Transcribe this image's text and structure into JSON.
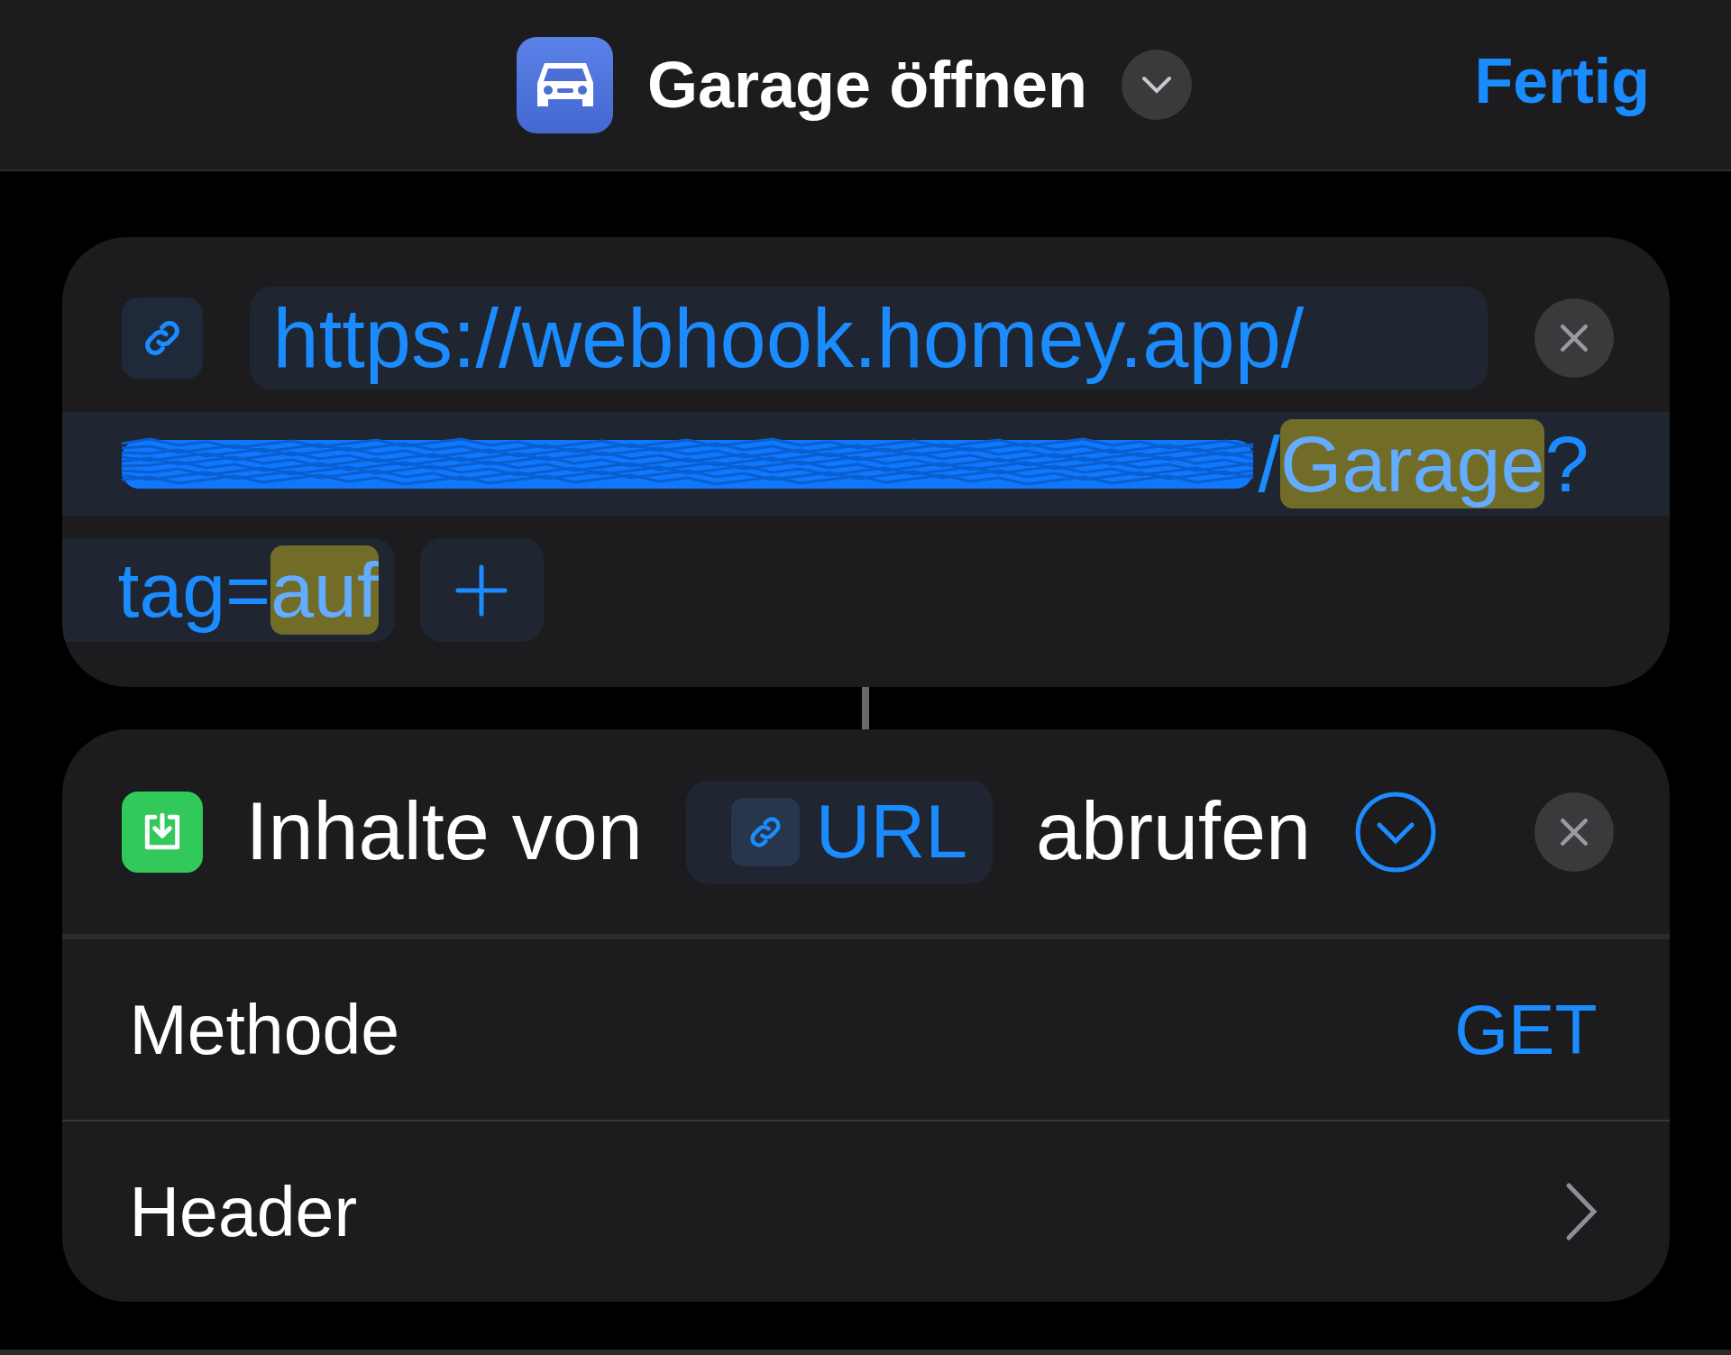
{
  "header": {
    "title": "Garage öffnen",
    "done": "Fertig"
  },
  "url_action": {
    "url": "https://webhook.homey.app/",
    "path": [
      {
        "text": "/",
        "highlighted": false
      },
      {
        "text": "Garage",
        "highlighted": true
      },
      {
        "text": "?",
        "highlighted": false
      }
    ],
    "param": [
      {
        "text": "tag=",
        "highlighted": false
      },
      {
        "text": "auf",
        "highlighted": true
      }
    ]
  },
  "fetch_action": {
    "prefix": "Inhalte von",
    "variable": "URL",
    "suffix": "abrufen"
  },
  "options": [
    {
      "kind": "value",
      "label": "Methode",
      "value": "GET"
    },
    {
      "kind": "link",
      "label": "Header"
    }
  ]
}
